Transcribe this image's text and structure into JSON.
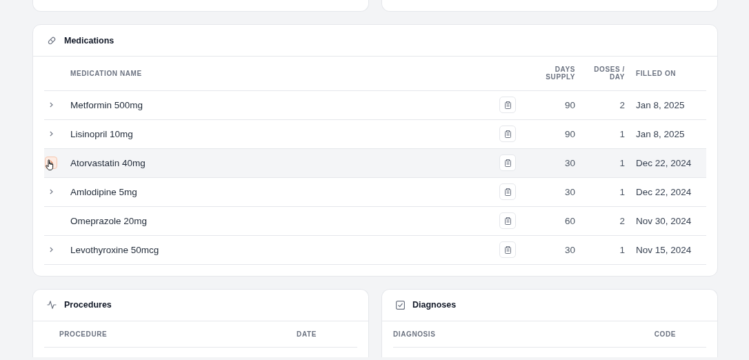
{
  "medications": {
    "title": "Medications",
    "columns": [
      "MEDICATION NAME",
      "DAYS\nSUPPLY",
      "DOSES /\nDAY",
      "FILLED ON"
    ],
    "rows": [
      {
        "name": "Metformin 500mg",
        "days_supply": "90",
        "doses_per_day": "2",
        "filled_on": "Jan 8, 2025",
        "expandable": true,
        "hovered": false
      },
      {
        "name": "Lisinopril 10mg",
        "days_supply": "90",
        "doses_per_day": "1",
        "filled_on": "Jan 8, 2025",
        "expandable": true,
        "hovered": false
      },
      {
        "name": "Atorvastatin 40mg",
        "days_supply": "30",
        "doses_per_day": "1",
        "filled_on": "Dec 22, 2024",
        "expandable": true,
        "hovered": true
      },
      {
        "name": "Amlodipine 5mg",
        "days_supply": "30",
        "doses_per_day": "1",
        "filled_on": "Dec 22, 2024",
        "expandable": true,
        "hovered": false
      },
      {
        "name": "Omeprazole 20mg",
        "days_supply": "60",
        "doses_per_day": "2",
        "filled_on": "Nov 30, 2024",
        "expandable": false,
        "hovered": false
      },
      {
        "name": "Levothyroxine 50mcg",
        "days_supply": "30",
        "doses_per_day": "1",
        "filled_on": "Nov 15, 2024",
        "expandable": true,
        "hovered": false
      }
    ]
  },
  "procedures": {
    "title": "Procedures",
    "columns": [
      "PROCEDURE",
      "DATE"
    ]
  },
  "diagnoses": {
    "title": "Diagnoses",
    "columns": [
      "DIAGNOSIS",
      "CODE"
    ]
  }
}
